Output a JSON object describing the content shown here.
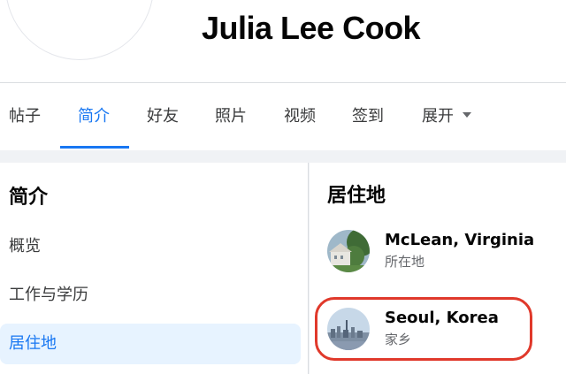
{
  "profile": {
    "name": "Julia Lee Cook"
  },
  "tabs": [
    {
      "label": "帖子"
    },
    {
      "label": "简介"
    },
    {
      "label": "好友"
    },
    {
      "label": "照片"
    },
    {
      "label": "视频"
    },
    {
      "label": "签到"
    },
    {
      "label": "展开"
    }
  ],
  "active_tab": "简介",
  "about": {
    "title": "简介",
    "nav": [
      {
        "label": "概览"
      },
      {
        "label": "工作与学历"
      },
      {
        "label": "居住地"
      }
    ],
    "active_nav": "居住地"
  },
  "places": {
    "title": "居住地",
    "items": [
      {
        "name": "McLean, Virginia",
        "sub": "所在地"
      },
      {
        "name": "Seoul, Korea",
        "sub": "家乡"
      }
    ]
  },
  "colors": {
    "accent": "#1877f2",
    "highlight": "#e0392b"
  }
}
